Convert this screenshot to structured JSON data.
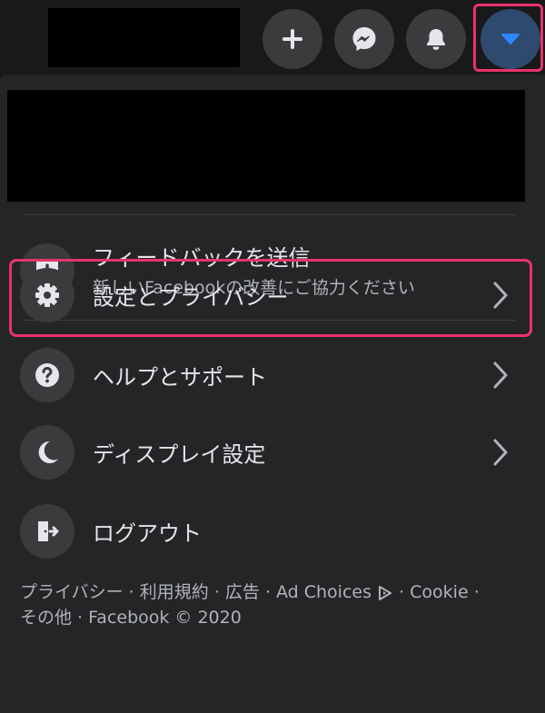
{
  "menu": {
    "feedback": {
      "title": "フィードバックを送信",
      "subtitle": "新しいFacebookの改善にご協力ください"
    },
    "settings_label": "設定とプライバシー",
    "help_label": "ヘルプとサポート",
    "display_label": "ディスプレイ設定",
    "logout_label": "ログアウト"
  },
  "footer": {
    "line1_before": "プライバシー · 利用規約 · 広告 · Ad Choices",
    "line1_after": " · Cookie ·",
    "line2": "その他 · Facebook © 2020"
  },
  "colors": {
    "highlight": "#e8336b",
    "accent": "#2d88ff"
  },
  "icons": [
    "plus-icon",
    "messenger-icon",
    "bell-icon",
    "caret-down-icon",
    "exclamation-icon",
    "gear-icon",
    "question-icon",
    "moon-icon",
    "logout-icon",
    "chevron-right-icon",
    "ad-choices-icon"
  ]
}
